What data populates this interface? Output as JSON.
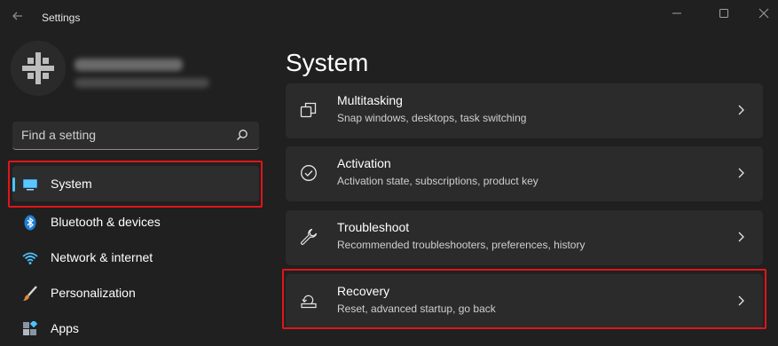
{
  "app": {
    "title": "Settings"
  },
  "search": {
    "placeholder": "Find a setting"
  },
  "nav": {
    "items": [
      {
        "label": "System",
        "icon": "monitor-icon",
        "selected": true
      },
      {
        "label": "Bluetooth & devices",
        "icon": "bluetooth-icon",
        "selected": false
      },
      {
        "label": "Network & internet",
        "icon": "wifi-icon",
        "selected": false
      },
      {
        "label": "Personalization",
        "icon": "brush-icon",
        "selected": false
      },
      {
        "label": "Apps",
        "icon": "apps-icon",
        "selected": false
      }
    ]
  },
  "main": {
    "title": "System",
    "cards": [
      {
        "title": "Multitasking",
        "description": "Snap windows, desktops, task switching",
        "icon": "multitasking-icon"
      },
      {
        "title": "Activation",
        "description": "Activation state, subscriptions, product key",
        "icon": "activation-check-icon"
      },
      {
        "title": "Troubleshoot",
        "description": "Recommended troubleshooters, preferences, history",
        "icon": "wrench-icon"
      },
      {
        "title": "Recovery",
        "description": "Reset, advanced startup, go back",
        "icon": "recovery-icon"
      }
    ]
  },
  "colors": {
    "background": "#202020",
    "card": "#2b2b2b",
    "accent": "#4cc2ff",
    "highlight": "#e0151b"
  }
}
